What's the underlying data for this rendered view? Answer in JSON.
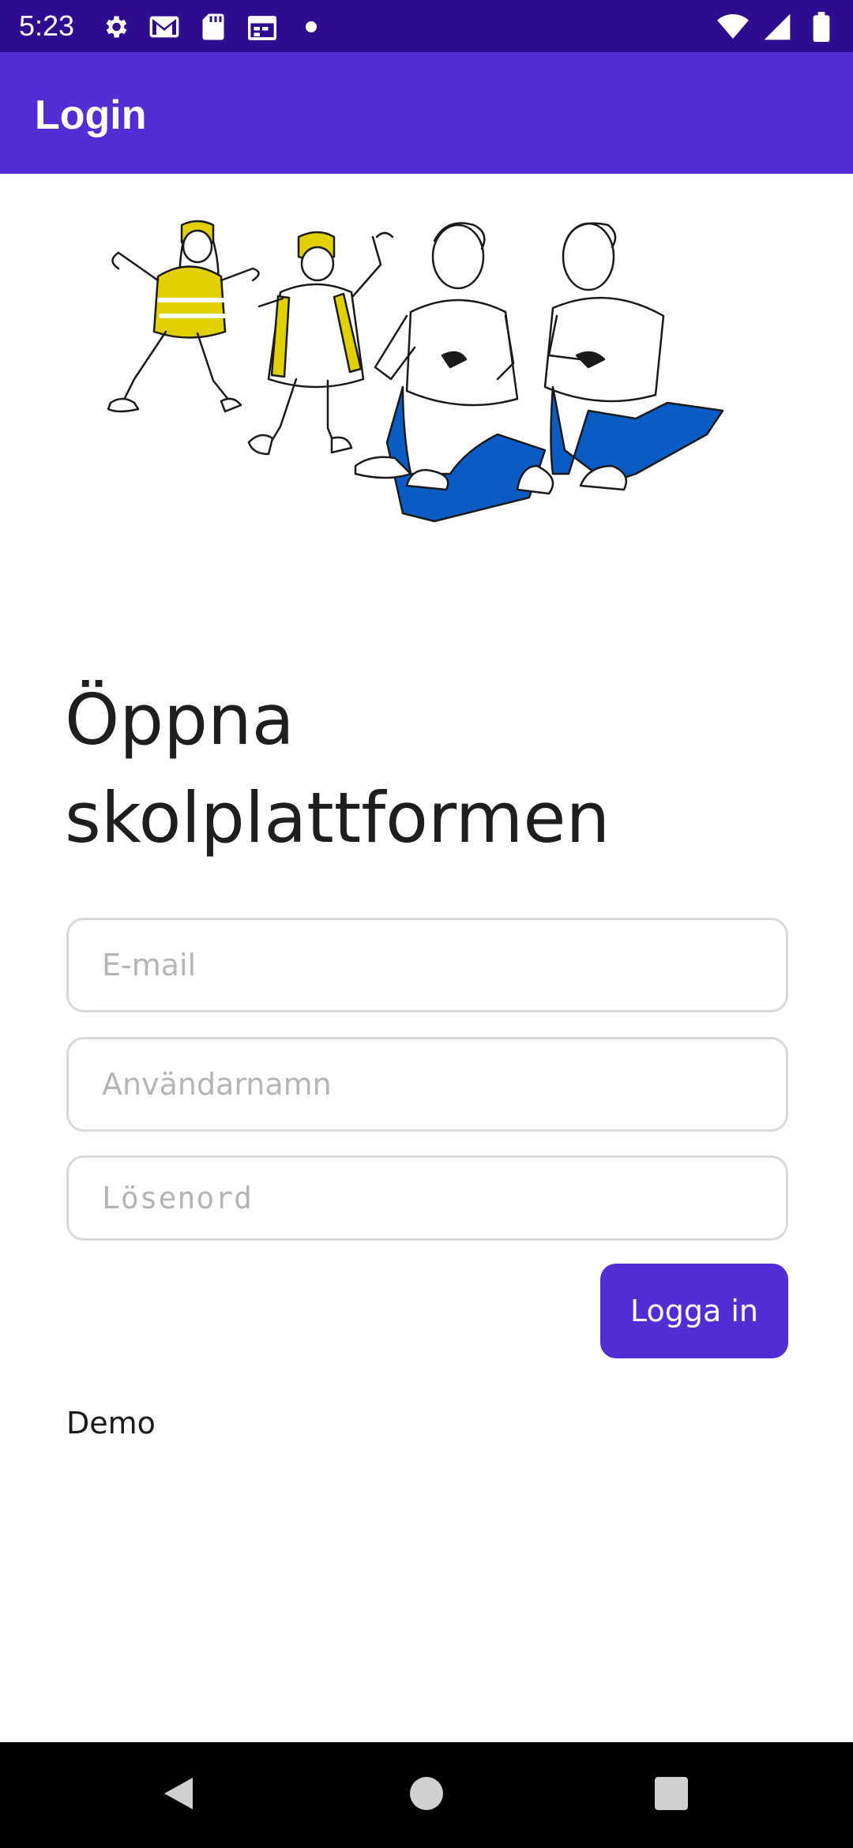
{
  "status_bar": {
    "time": "5:23",
    "icons_left": [
      "settings-icon",
      "gmail-icon",
      "sd-card-icon",
      "calendar-icon",
      "dot-icon"
    ],
    "icons_right": [
      "wifi-icon",
      "signal-icon",
      "battery-icon"
    ]
  },
  "app_bar": {
    "title": "Login"
  },
  "main": {
    "heading_line1": "Öppna",
    "heading_line2": "skolplattformen",
    "email": {
      "placeholder": "E-mail",
      "value": ""
    },
    "username": {
      "placeholder": "Användarnamn",
      "value": ""
    },
    "password": {
      "placeholder": "Lösenord",
      "value": ""
    },
    "login_button": "Logga in",
    "demo_link": "Demo"
  },
  "colors": {
    "status_bar": "#2f0c8f",
    "app_bar": "#522dd3",
    "accent": "#522dd3",
    "illustration_yellow": "#e2d100",
    "illustration_blue": "#0a5cc4"
  },
  "nav_bar": {
    "buttons": [
      "back-icon",
      "home-icon",
      "recents-icon"
    ]
  }
}
